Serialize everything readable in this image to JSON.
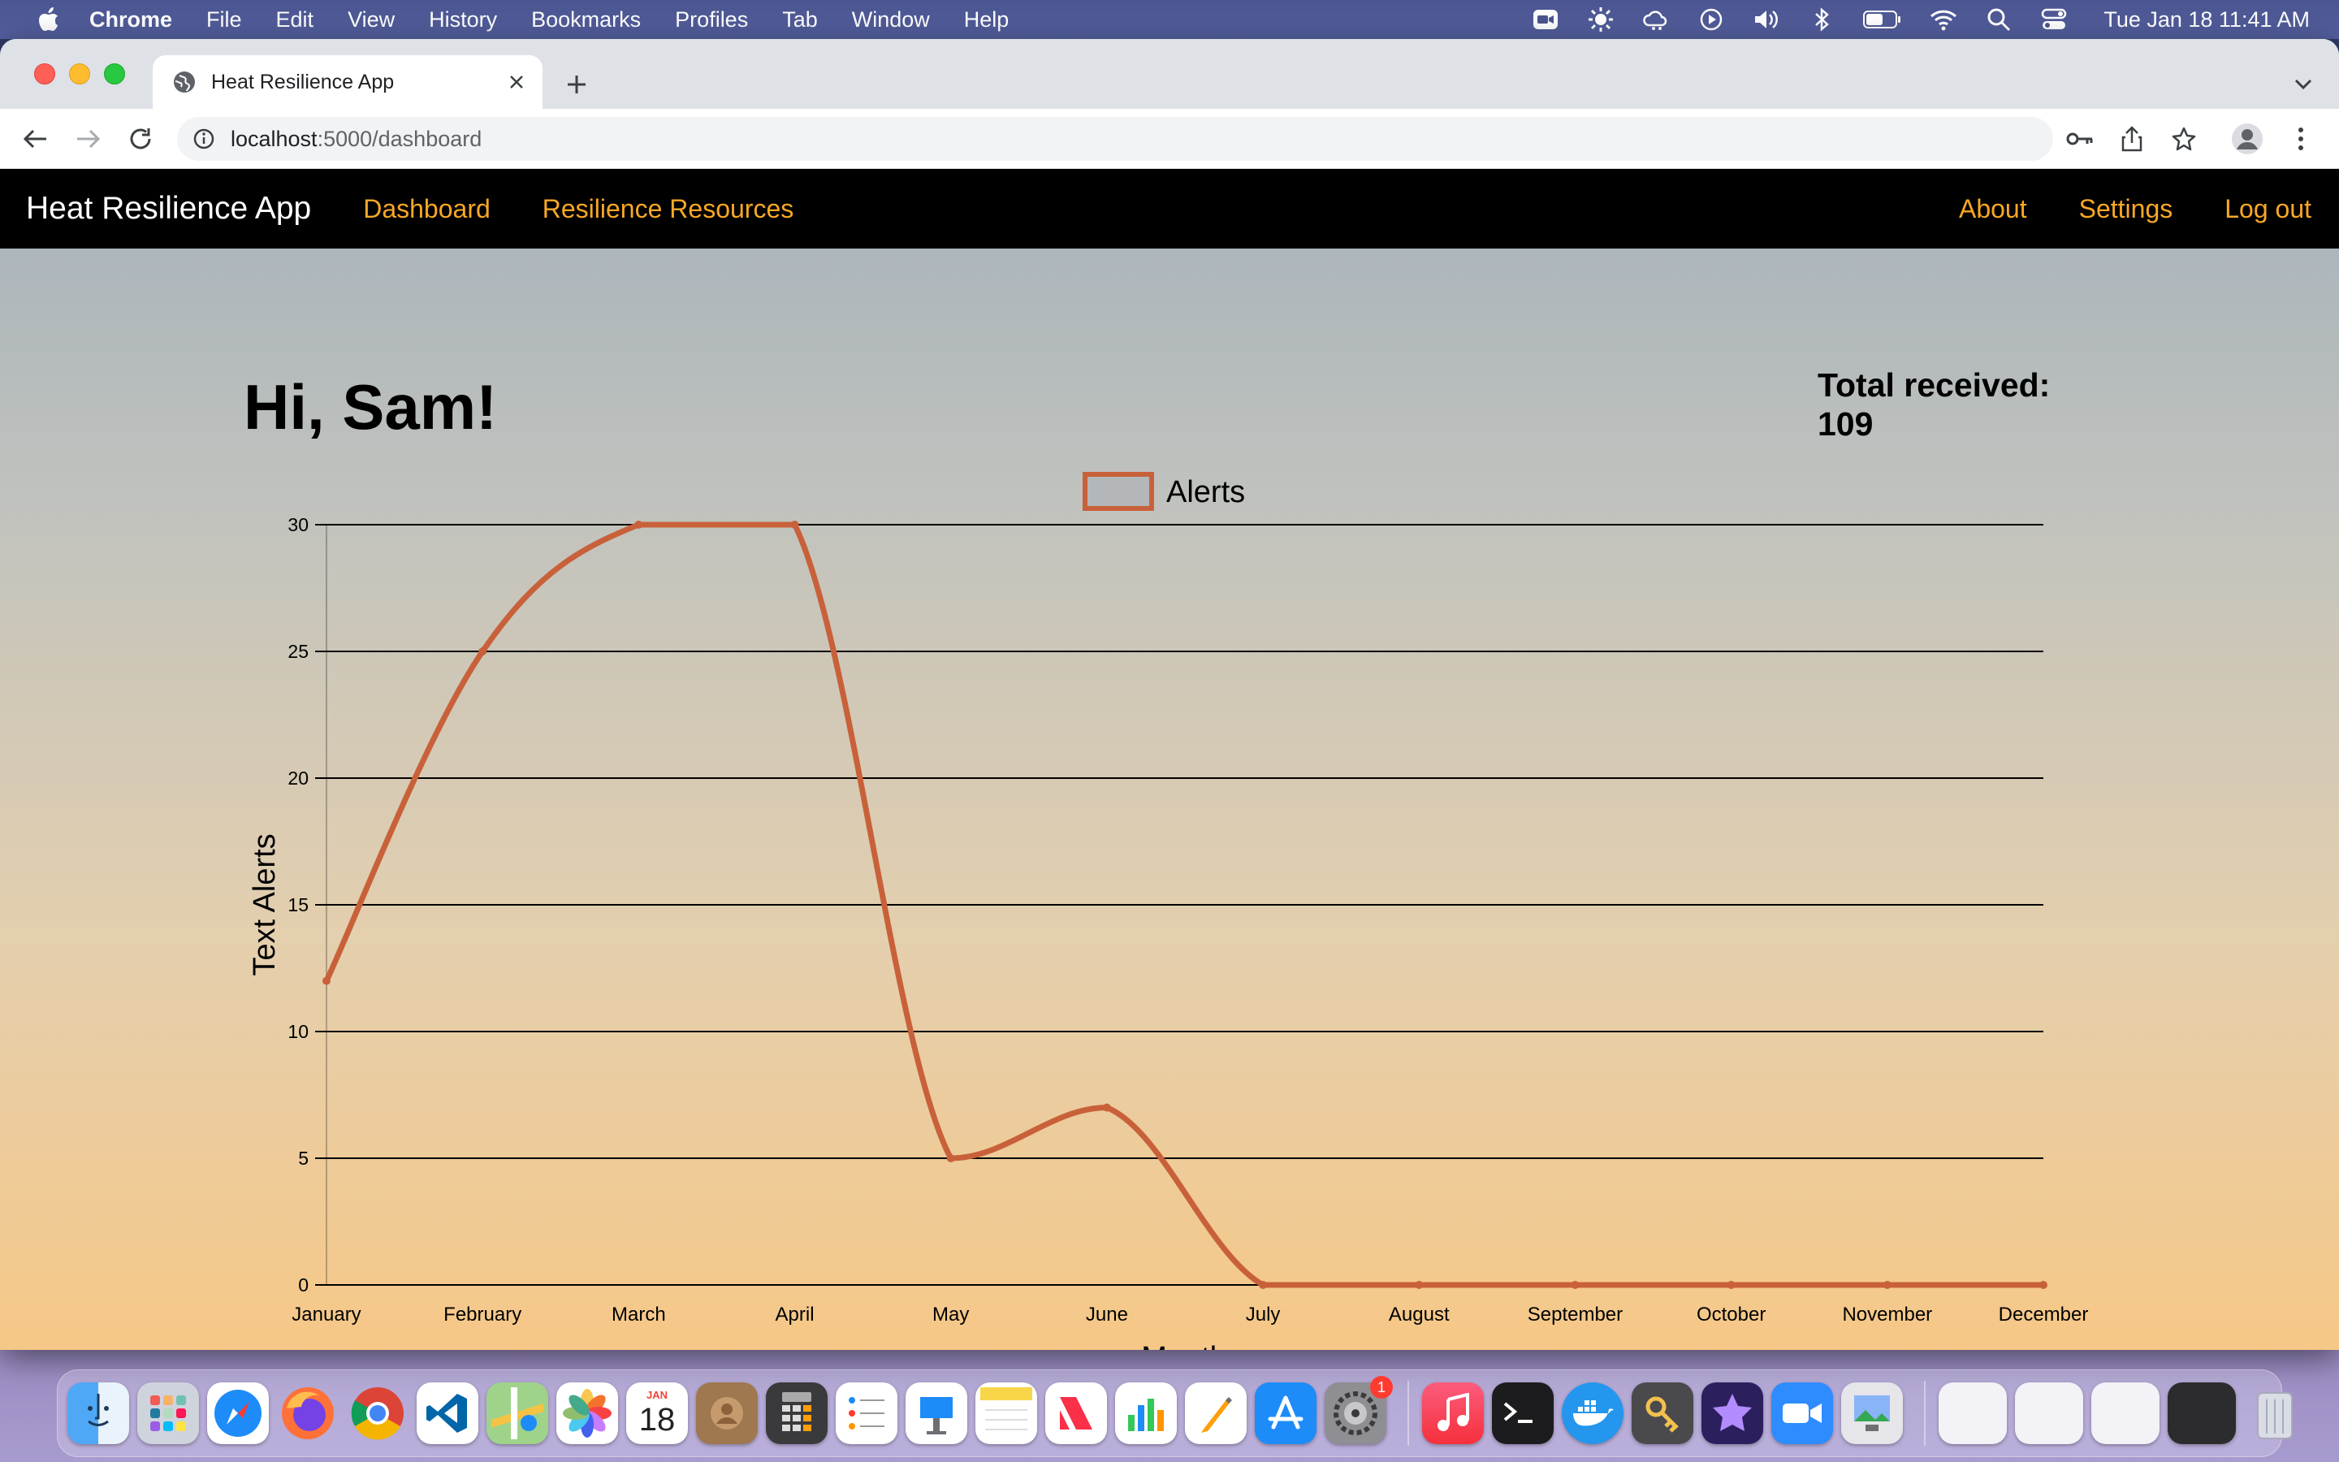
{
  "menubar": {
    "app_name": "Chrome",
    "items": [
      "File",
      "Edit",
      "View",
      "History",
      "Bookmarks",
      "Profiles",
      "Tab",
      "Window",
      "Help"
    ],
    "clock": "Tue Jan 18  11:41 AM",
    "status_icons": [
      "zoom-icon",
      "brightness-icon",
      "weather-icon",
      "play-icon",
      "volume-icon",
      "bluetooth-icon",
      "battery-icon",
      "wifi-icon",
      "spotlight-icon",
      "control-center-icon"
    ]
  },
  "browser": {
    "tab_title": "Heat Resilience App",
    "url_host": "localhost",
    "url_path": ":5000/dashboard"
  },
  "appnav": {
    "brand": "Heat Resilience App",
    "links": [
      "Dashboard",
      "Resilience Resources"
    ],
    "right_links": [
      "About",
      "Settings",
      "Log out"
    ],
    "link_color": "#f9a825"
  },
  "dashboard": {
    "greeting": "Hi, Sam!",
    "total_label": "Total received:",
    "total_value": "109"
  },
  "chart_data": {
    "type": "line",
    "categories": [
      "January",
      "February",
      "March",
      "April",
      "May",
      "June",
      "July",
      "August",
      "September",
      "October",
      "November",
      "December"
    ],
    "series": [
      {
        "name": "Alerts",
        "values": [
          12,
          25,
          30,
          30,
          5,
          7,
          0,
          0,
          0,
          0,
          0,
          0
        ],
        "color": "#c8613a"
      }
    ],
    "xlabel": "Month",
    "ylabel": "Text Alerts",
    "ylim": [
      0,
      30
    ],
    "yticks": [
      0,
      5,
      10,
      15,
      20,
      25,
      30
    ],
    "grid": true,
    "legend": "top-center"
  },
  "dock": {
    "icons": [
      "finder-icon",
      "launchpad-icon",
      "safari-icon",
      "firefox-icon",
      "chrome-icon",
      "vscode-icon",
      "maps-icon",
      "photos-icon",
      "calendar-icon",
      "contacts-icon",
      "calculator-icon",
      "reminders-icon",
      "keynote-icon",
      "notes-icon",
      "news-icon",
      "numbers-icon",
      "pages-icon",
      "app-store-icon",
      "system-preferences-icon",
      "music-icon",
      "terminal-icon",
      "docker-icon",
      "keychain-icon",
      "imovie-icon",
      "zoom-icon",
      "preview-icon"
    ],
    "calendar_month": "JAN",
    "calendar_day": "18",
    "sysprefs_badge": "1"
  }
}
